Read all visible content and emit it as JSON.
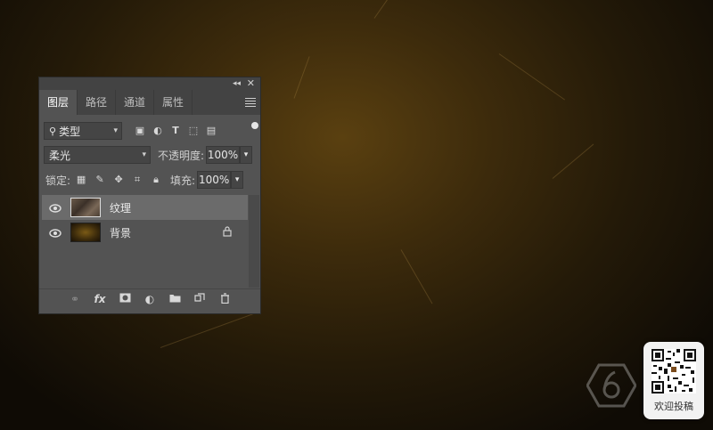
{
  "panel": {
    "tabs": [
      {
        "label": "图层",
        "active": true
      },
      {
        "label": "路径",
        "active": false
      },
      {
        "label": "通道",
        "active": false
      },
      {
        "label": "属性",
        "active": false
      }
    ],
    "filter": {
      "label": "类型"
    },
    "blend_mode": "柔光",
    "opacity": {
      "label": "不透明度:",
      "value": "100%"
    },
    "lock": {
      "label": "锁定:"
    },
    "fill": {
      "label": "填充:",
      "value": "100%"
    },
    "layers": [
      {
        "name": "纹理",
        "selected": true,
        "visible": true,
        "locked": false
      },
      {
        "name": "背景",
        "selected": false,
        "visible": true,
        "locked": true
      }
    ],
    "footer_fx": "fx"
  },
  "qr_card": {
    "caption": "欢迎投稿"
  },
  "colors": {
    "panel": "#535353",
    "tab_bar": "#434343",
    "selected_layer": "#6b6b6b"
  }
}
